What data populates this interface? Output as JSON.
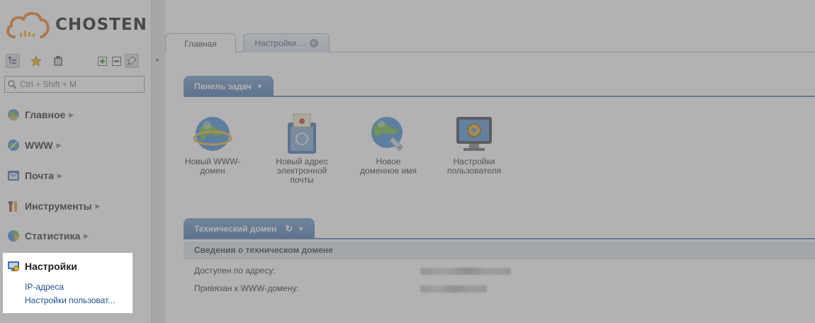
{
  "brand": {
    "name": "CHOSTEN"
  },
  "search": {
    "placeholder": "Ctrl + Shift + M"
  },
  "toolbar": {
    "buttons": [
      "tree-view-icon",
      "star-icon",
      "clipboard-icon",
      "expand-all-icon",
      "collapse-all-icon",
      "pin-icon"
    ]
  },
  "nav": {
    "items": [
      {
        "label": "Главное",
        "icon": "globe-icon"
      },
      {
        "label": "WWW",
        "icon": "www-icon"
      },
      {
        "label": "Почта",
        "icon": "mail-icon"
      },
      {
        "label": "Инструменты",
        "icon": "tools-icon"
      },
      {
        "label": "Статистика",
        "icon": "chart-icon"
      },
      {
        "label": "Настройки",
        "icon": "settings-icon"
      }
    ],
    "settings_sub": [
      "IP-адреса",
      "Настройки пользоват..."
    ]
  },
  "tabs": [
    {
      "label": "Главная",
      "active": true
    },
    {
      "label": "Настройки ...",
      "active": false,
      "closable": true
    }
  ],
  "taskbar": {
    "title": "Панель задач",
    "tasks": [
      {
        "label_lines": [
          "Новый WWW-",
          "домен"
        ],
        "icon": "globe-icon"
      },
      {
        "label_lines": [
          "Новый адрес",
          "электронной",
          "почты"
        ],
        "icon": "mailbox-icon"
      },
      {
        "label_lines": [
          "Новое",
          "доменное имя"
        ],
        "icon": "domain-tag-icon"
      },
      {
        "label_lines": [
          "Настройки",
          "пользователя"
        ],
        "icon": "monitor-gear-icon"
      }
    ]
  },
  "tech_domain": {
    "title": "Технический домен",
    "section": "Сведения о техническом домене",
    "rows": [
      {
        "label": "Доступен по адресу:"
      },
      {
        "label": "Привязан к WWW-домену:"
      }
    ]
  },
  "colors": {
    "accent": "#4d7bb8",
    "panel_header": "#5282be",
    "link": "#1d4f8c",
    "overlay": "#767676",
    "logo_orange": "#f07b22"
  }
}
